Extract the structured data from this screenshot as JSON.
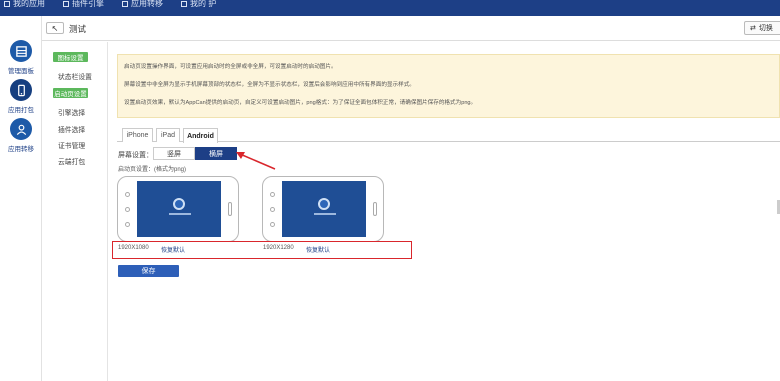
{
  "topnav": {
    "items": [
      {
        "label": "我的应用",
        "icon": "apps-icon"
      },
      {
        "label": "插件引擎",
        "icon": "plugin-icon"
      },
      {
        "label": "应用转移",
        "icon": "transfer-icon"
      },
      {
        "label": "我的 护",
        "icon": "user-icon"
      }
    ]
  },
  "sidebar": {
    "items": [
      {
        "label": "管理面板",
        "icon": "dashboard-icon"
      },
      {
        "label": "应用打包",
        "icon": "package-icon"
      },
      {
        "label": "应用转移",
        "icon": "transfer-icon"
      }
    ]
  },
  "subbar": {
    "back_icon": "back-arrow-icon",
    "title": "测试",
    "switch_label": "切换"
  },
  "menu": {
    "group1": "图标设置",
    "group1_items": [
      "状态栏设置"
    ],
    "group2": "启动页设置",
    "group2_items": [
      "引擎选择",
      "插件选择",
      "证书管理",
      "云端打包"
    ]
  },
  "notice": {
    "lines": [
      "启动页设置操作界面，可设置应用启动时的全屏或非全屏，可设置启动时的启动图片。",
      "屏幕设置中非全屏为显示手机屏幕顶部的状态栏，全屏为不显示状态栏，设置后会影响到应用中所有界面的显示样式。",
      "设置启动页效果，默认为AppCan提供的启动页，自定义可设置启动图片，png格式：为了保证全面包体积正常，请确保图片保存的格式为png。"
    ]
  },
  "tabs": [
    {
      "label": "iPhone",
      "active": false
    },
    {
      "label": "iPad",
      "active": false
    },
    {
      "label": "Android",
      "active": true
    }
  ],
  "orientation": {
    "label": "屏幕设置：",
    "portrait": "竖屏",
    "landscape": "横屏",
    "selected": "横屏"
  },
  "image_label": "启动页设置：(格式为png)",
  "resolutions": [
    {
      "size": "1920X1080",
      "reset": "恢复默认"
    },
    {
      "size": "1920X1280",
      "reset": "恢复默认"
    }
  ],
  "save_label": "保存",
  "colors": {
    "nav": "#1d3f86",
    "accent": "#2e5fb8",
    "green": "#5cb85c",
    "highlight": "#d9262c"
  }
}
